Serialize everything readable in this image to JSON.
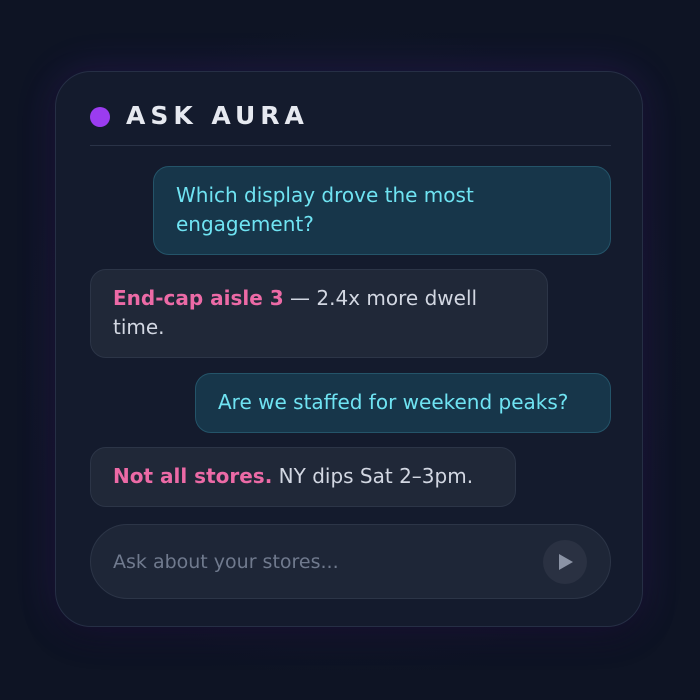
{
  "header": {
    "title": "ASK AURA",
    "status_color": "#9b3cf0"
  },
  "messages": [
    {
      "role": "user",
      "text": "Which display drove the most engagement?"
    },
    {
      "role": "assistant",
      "lead": "End-cap aisle 3",
      "text": " — 2.4x more dwell time."
    },
    {
      "role": "user",
      "text": "Are we staffed for weekend peaks?"
    },
    {
      "role": "assistant",
      "lead": "Not all stores.",
      "text": " NY dips Sat 2–3pm."
    }
  ],
  "composer": {
    "placeholder": "Ask about your stores...",
    "value": "",
    "send_icon": "send-icon"
  },
  "colors": {
    "accent_pink": "#ec6aa6",
    "user_text": "#6fe3f2",
    "background": "#0e1424"
  }
}
